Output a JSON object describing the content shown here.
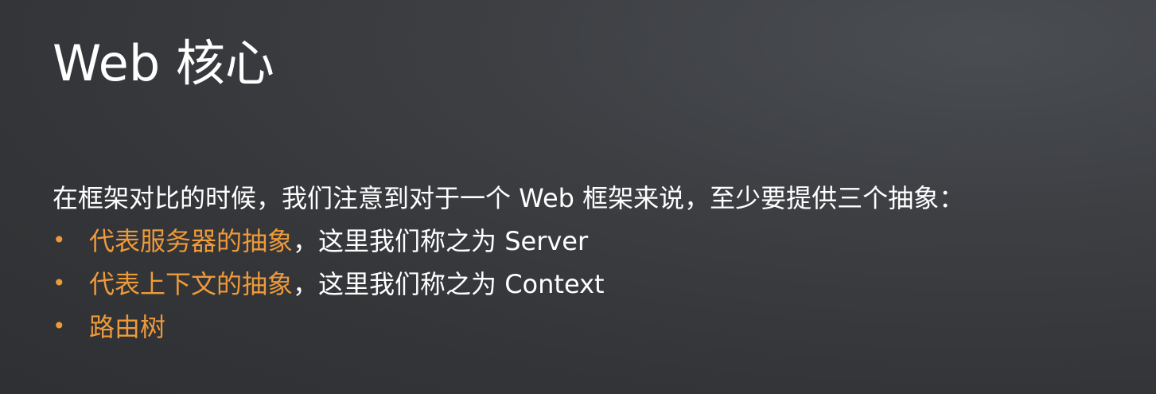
{
  "slide": {
    "title": "Web 核心",
    "intro": "在框架对比的时候，我们注意到对于一个 Web 框架来说，至少要提供三个抽象：",
    "bullet_marker": "•",
    "bullets": [
      {
        "highlight": "代表服务器的抽象",
        "rest": "，这里我们称之为 Server"
      },
      {
        "highlight": "代表上下文的抽象",
        "rest": "，这里我们称之为 Context"
      },
      {
        "highlight": "路由树",
        "rest": ""
      }
    ]
  },
  "colors": {
    "accent": "#ee9a3a",
    "text": "#ffffff",
    "background": "#3a3c40"
  }
}
